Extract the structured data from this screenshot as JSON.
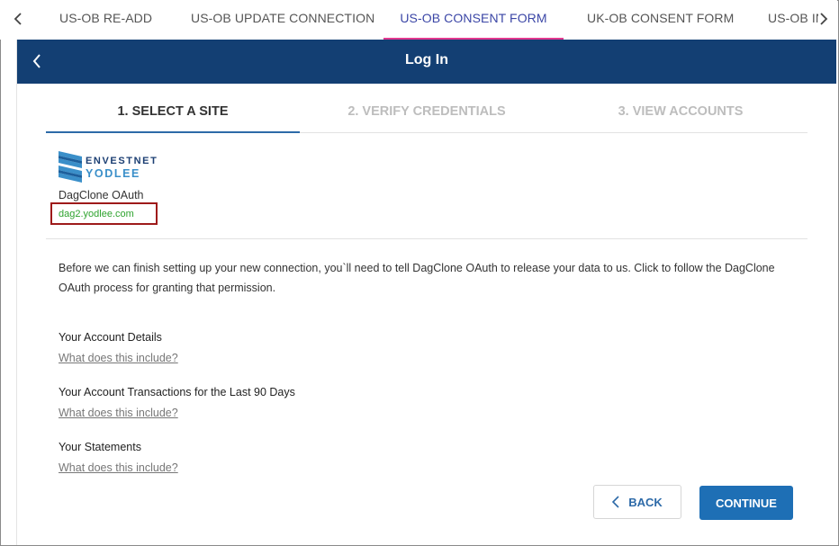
{
  "tabs": [
    {
      "label": "US-OB RE-ADD",
      "active": false
    },
    {
      "label": "US-OB UPDATE CONNECTION",
      "active": false
    },
    {
      "label": "US-OB CONSENT FORM",
      "active": true
    },
    {
      "label": "UK-OB CONSENT FORM",
      "active": false
    },
    {
      "label": "US-OB IN",
      "active": false
    }
  ],
  "header": {
    "title": "Log In"
  },
  "steps": [
    {
      "label": "1. SELECT A SITE",
      "active": true
    },
    {
      "label": "2. VERIFY CREDENTIALS",
      "active": false
    },
    {
      "label": "3. VIEW ACCOUNTS",
      "active": false
    }
  ],
  "site": {
    "logo_line1": "ENVESTNET",
    "logo_line2": "YODLEE",
    "name": "DagClone OAuth",
    "url": "dag2.yodlee.com"
  },
  "description": "Before we can finish setting up your new connection, you`ll need to tell DagClone OAuth to release your data to us. Click to follow the DagClone OAuth process for granting that permission.",
  "details": [
    {
      "title": "Your Account Details",
      "link": "What does this include?"
    },
    {
      "title": "Your Account Transactions for the Last 90 Days",
      "link": "What does this include?"
    },
    {
      "title": "Your Statements",
      "link": "What does this include?"
    }
  ],
  "buttons": {
    "back": "BACK",
    "continue": "CONTINUE"
  },
  "colors": {
    "header_bg": "#133f73",
    "active_tab": "#3b46a6",
    "tab_underline": "#e23a8f",
    "url_green": "#2ea32e",
    "highlight_box": "#9e1a1a",
    "primary_button": "#1e6fb5"
  }
}
